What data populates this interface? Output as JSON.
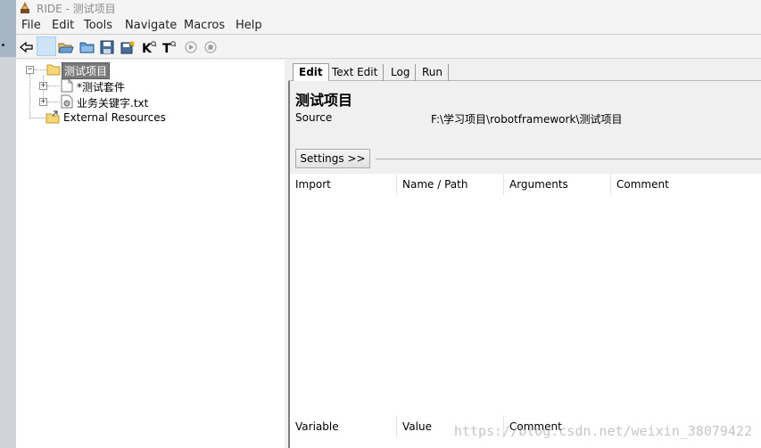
{
  "window": {
    "title": "RIDE - 测试项目"
  },
  "menu": {
    "items": [
      "File",
      "Edit",
      "Tools",
      "Navigate",
      "Macros",
      "Help"
    ]
  },
  "toolbar": {
    "buttons": [
      "back-arrow-icon",
      "blank-selected",
      "open-folder-icon",
      "folder-icon",
      "save-icon",
      "save-all-icon",
      "keyword-search-icon",
      "test-search-icon",
      "run-icon",
      "stop-icon"
    ],
    "letters": {
      "k": "K",
      "t": "T"
    }
  },
  "tree": {
    "root": "测试项目",
    "children": [
      "*测试套件",
      "业务关键字.txt"
    ],
    "external": "External Resources",
    "expander_collapsed": "+",
    "expander_expanded": "−"
  },
  "tabs": [
    "Edit",
    "Text Edit",
    "Log",
    "Run"
  ],
  "editor": {
    "title": "测试项目",
    "source_label": "Source",
    "source_value": "F:\\学习项目\\robotframework\\测试项目",
    "settings_button": "Settings >>",
    "import_columns": [
      "Import",
      "Name / Path",
      "Arguments",
      "Comment"
    ],
    "variable_columns": [
      "Variable",
      "Value",
      "Comment"
    ]
  },
  "watermark": "https://blog.csdn.net/weixin_38079422",
  "colors": {
    "selection": "#7a7a7a",
    "toolbar_active": "#cde4f7"
  }
}
